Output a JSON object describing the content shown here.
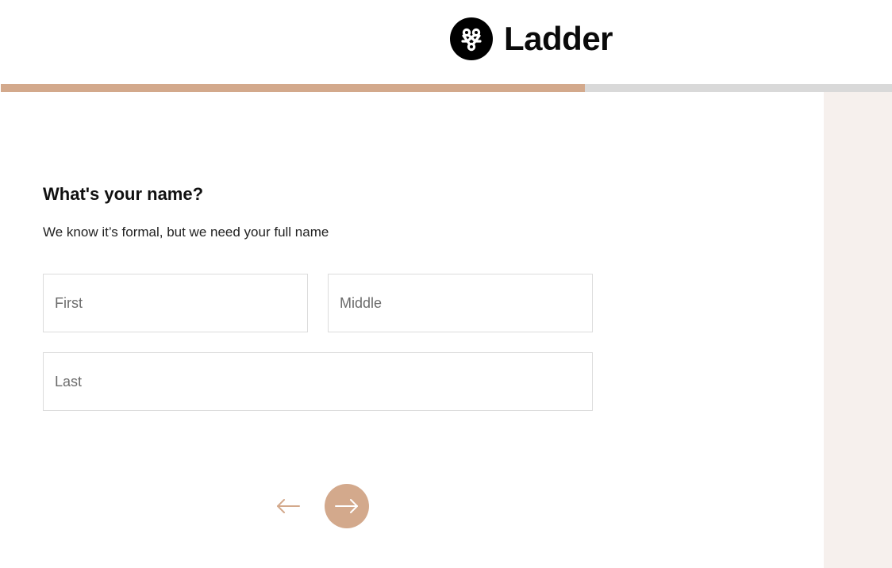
{
  "brand": {
    "name": "Ladder",
    "logo_icon": "ladder-knot-icon",
    "accent_color": "#d3a98c",
    "side_panel_color": "#f6f0ed"
  },
  "progress": {
    "percent": 65.5
  },
  "question": {
    "title": "What's your name?",
    "subtitle": "We know it’s formal, but we need your full name"
  },
  "fields": {
    "first": {
      "placeholder": "First",
      "value": ""
    },
    "middle": {
      "placeholder": "Middle",
      "value": ""
    },
    "last": {
      "placeholder": "Last",
      "value": ""
    }
  },
  "navigation": {
    "back_icon": "arrow-left-icon",
    "next_icon": "arrow-right-icon"
  }
}
